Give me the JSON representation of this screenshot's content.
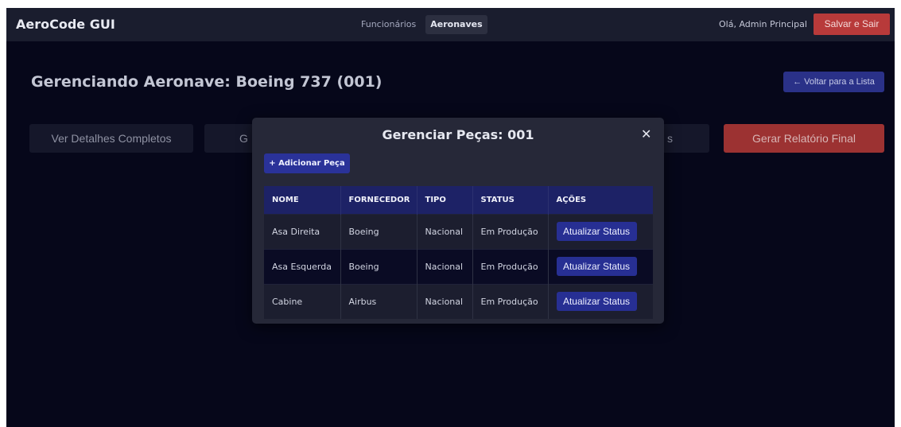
{
  "navbar": {
    "brand": "AeroCode GUI",
    "links": [
      {
        "label": "Funcionários"
      },
      {
        "label": "Aeronaves"
      }
    ],
    "greeting": "Olá, Admin Principal",
    "logout_label": "Salvar e Sair"
  },
  "page": {
    "title": "Gerenciando Aeronave: Boeing 737 (001)",
    "back_label": "← Voltar para a Lista",
    "actions": [
      {
        "label": "Ver Detalhes Completos"
      },
      {
        "label": "G"
      },
      {
        "label": "s"
      },
      {
        "label": "Gerar Relatório Final"
      }
    ]
  },
  "modal": {
    "title": "Gerenciar Peças: 001",
    "close_symbol": "✕",
    "add_label": "+ Adicionar Peça",
    "columns": [
      "NOME",
      "FORNECEDOR",
      "TIPO",
      "STATUS",
      "AÇÕES"
    ],
    "rows": [
      {
        "nome": "Asa Direita",
        "fornecedor": "Boeing",
        "tipo": "Nacional",
        "status": "Em Produção",
        "acao": "Atualizar Status"
      },
      {
        "nome": "Asa Esquerda",
        "fornecedor": "Boeing",
        "tipo": "Nacional",
        "status": "Em Produção",
        "acao": "Atualizar Status"
      },
      {
        "nome": "Cabine",
        "fornecedor": "Airbus",
        "tipo": "Nacional",
        "status": "Em Produção",
        "acao": "Atualizar Status"
      }
    ]
  },
  "colors": {
    "background": "#06071a",
    "navbar": "#1a1d2e",
    "danger": "#b83a3a",
    "primary": "#2a3299",
    "table_header": "#1d2266"
  }
}
